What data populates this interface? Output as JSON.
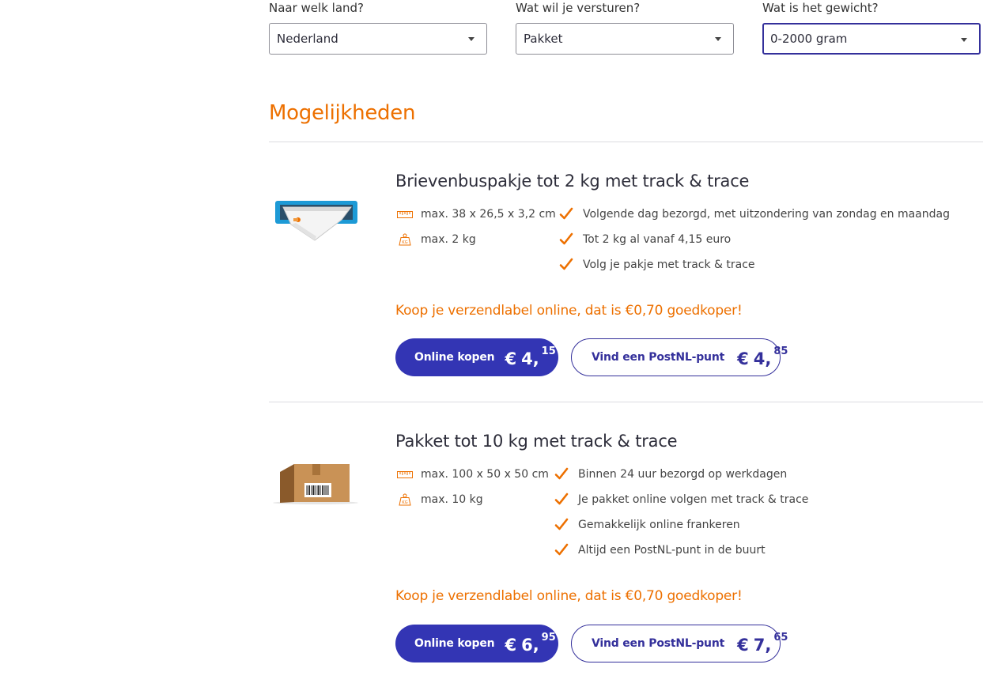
{
  "filters": {
    "country": {
      "label": "Naar welk land?",
      "value": "Nederland"
    },
    "type": {
      "label": "Wat wil je versturen?",
      "value": "Pakket"
    },
    "weight": {
      "label": "Wat is het gewicht?",
      "value": "0-2000 gram"
    }
  },
  "section_title": "Mogelijkheden",
  "products": [
    {
      "title": "Brievenbuspakje tot 2 kg met track & trace",
      "image": "mailbox-package-illustration",
      "specs": [
        {
          "icon": "ruler-icon",
          "text": "max. 38 x 26,5 x 3,2 cm"
        },
        {
          "icon": "weight-kg-icon",
          "text": "max. 2 kg"
        }
      ],
      "features": [
        "Volgende dag bezorgd, met uitzondering van zondag en maandag",
        "Tot 2 kg al vanaf 4,15 euro",
        "Volg je pakje met track & trace"
      ],
      "promo": "Koop je verzendlabel online, dat is €0,70 goedkoper!",
      "buy_online": {
        "label": "Online kopen",
        "currency": "€",
        "euros": "4,",
        "cents": "15"
      },
      "find_point": {
        "label": "Vind een PostNL-punt",
        "currency": "€",
        "euros": "4,",
        "cents": "85"
      }
    },
    {
      "title": "Pakket tot 10 kg met track & trace",
      "image": "cardboard-box-illustration",
      "specs": [
        {
          "icon": "ruler-icon",
          "text": "max. 100 x 50 x 50 cm"
        },
        {
          "icon": "weight-kg-icon",
          "text": "max. 10 kg"
        }
      ],
      "features": [
        "Binnen 24 uur bezorgd op werkdagen",
        "Je pakket online volgen met track & trace",
        "Gemakkelijk online frankeren",
        "Altijd een PostNL-punt in de buurt"
      ],
      "promo": "Koop je verzendlabel online, dat is €0,70 goedkoper!",
      "buy_online": {
        "label": "Online kopen",
        "currency": "€",
        "euros": "6,",
        "cents": "95"
      },
      "find_point": {
        "label": "Vind een PostNL-punt",
        "currency": "€",
        "euros": "7,",
        "cents": "65"
      }
    }
  ],
  "colors": {
    "accent": "#ed7000",
    "primary": "#3335b4",
    "text": "#2d2d3a"
  }
}
